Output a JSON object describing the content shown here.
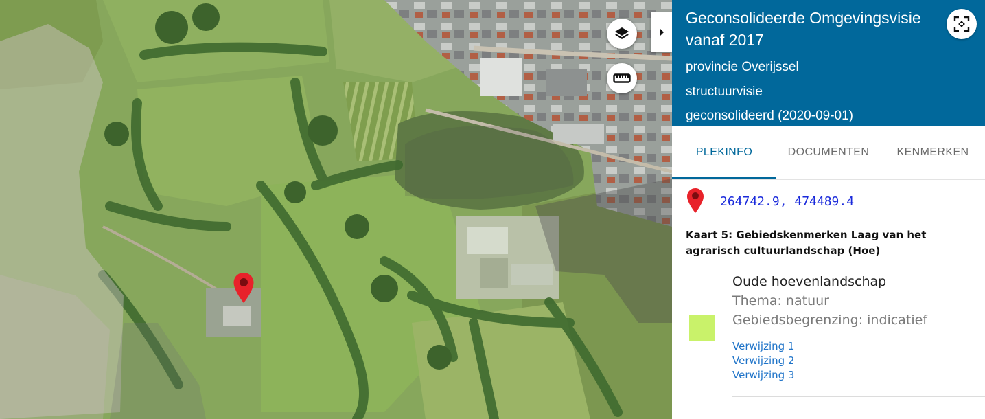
{
  "panel": {
    "title": "Geconsolideerde Omgevingsvisie vanaf 2017",
    "authority": "provincie Overijssel",
    "plan_type": "structuurvisie",
    "status": "geconsolideerd (2020-09-01)",
    "header_color": "#01689b"
  },
  "tabs": [
    {
      "label": "PLEKINFO",
      "active": true
    },
    {
      "label": "DOCUMENTEN",
      "active": false
    },
    {
      "label": "KENMERKEN",
      "active": false
    }
  ],
  "location": {
    "coordinates": "264742.9, 474489.4",
    "pin_color": "#e8222a"
  },
  "map_layer": {
    "title": "Kaart 5: Gebiedskenmerken Laag van het agrarisch cultuurlandschap (Hoe)"
  },
  "legend": {
    "name": "Oude hoevenlandschap",
    "theme": "Thema: natuur",
    "boundary": "Gebiedsbegrenzing: indicatief",
    "swatch_color": "#c9f26a",
    "references": [
      "Verwijzing 1",
      "Verwijzing 2",
      "Verwijzing 3"
    ]
  },
  "map_controls": {
    "layers_icon": "layers-icon",
    "measure_icon": "ruler-icon",
    "collapse_icon": "chevron-right-icon",
    "fullscreen_icon": "fullscreen-icon"
  }
}
